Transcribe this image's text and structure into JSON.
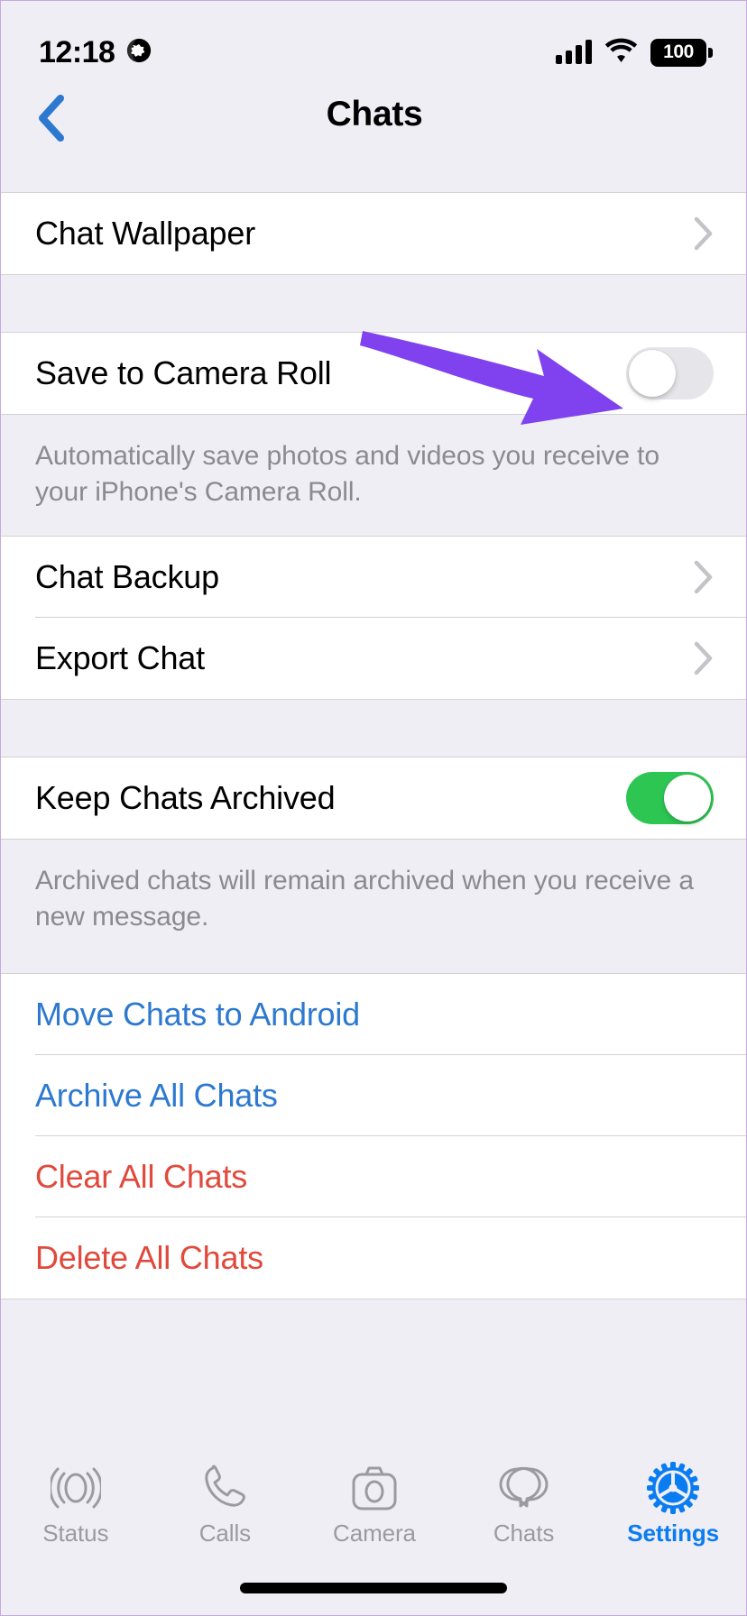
{
  "status_bar": {
    "time": "12:18",
    "location_icon": "globe-icon",
    "signal_icon": "cellular-signal-icon",
    "wifi_icon": "wifi-icon",
    "battery_level": "100"
  },
  "nav": {
    "back_icon": "back-chevron-icon",
    "title": "Chats"
  },
  "sections": {
    "wallpaper": {
      "rows": [
        {
          "label": "Chat Wallpaper",
          "accessory": "chevron-right-icon"
        }
      ]
    },
    "camera_roll": {
      "rows": [
        {
          "label": "Save to Camera Roll",
          "accessory": "toggle",
          "toggle_state": "off"
        }
      ],
      "footer": "Automatically save photos and videos you receive to your iPhone's Camera Roll."
    },
    "backup": {
      "rows": [
        {
          "label": "Chat Backup",
          "accessory": "chevron-right-icon"
        },
        {
          "label": "Export Chat",
          "accessory": "chevron-right-icon"
        }
      ]
    },
    "archive": {
      "rows": [
        {
          "label": "Keep Chats Archived",
          "accessory": "toggle",
          "toggle_state": "on"
        }
      ],
      "footer": "Archived chats will remain archived when you receive a new message."
    },
    "actions": {
      "rows": [
        {
          "label": "Move Chats to Android",
          "style": "blue"
        },
        {
          "label": "Archive All Chats",
          "style": "blue"
        },
        {
          "label": "Clear All Chats",
          "style": "red"
        },
        {
          "label": "Delete All Chats",
          "style": "red"
        }
      ]
    }
  },
  "tab_bar": {
    "tabs": [
      {
        "label": "Status",
        "icon": "status-rings-icon",
        "active": false
      },
      {
        "label": "Calls",
        "icon": "phone-icon",
        "active": false
      },
      {
        "label": "Camera",
        "icon": "camera-icon",
        "active": false
      },
      {
        "label": "Chats",
        "icon": "chat-bubbles-icon",
        "active": false
      },
      {
        "label": "Settings",
        "icon": "gear-icon",
        "active": true
      }
    ]
  },
  "annotation": {
    "type": "arrow",
    "color": "#7f42ee",
    "points_to": "save-to-camera-roll-toggle"
  },
  "colors": {
    "accent_blue": "#2d79d0",
    "destructive_red": "#e0493b",
    "toggle_on_green": "#2dc653",
    "toggle_off_gray": "#e6e6ea",
    "page_background": "#efeef4",
    "row_background": "#ffffff",
    "separator": "#d2d1d6",
    "footer_text": "#8a8a8f",
    "tab_active_blue": "#0a7cf1",
    "tab_inactive_gray": "#9a9aa0",
    "annotation_purple": "#7f42ee"
  }
}
